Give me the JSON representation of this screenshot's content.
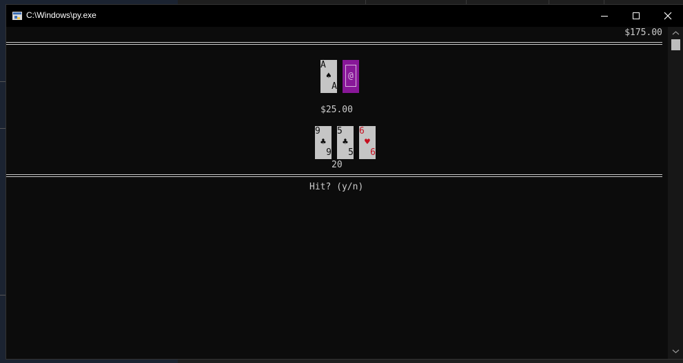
{
  "window": {
    "title": "C:\\Windows\\py.exe"
  },
  "game": {
    "bankroll": "$175.00",
    "bet": "$25.00",
    "dealer_cards": [
      {
        "rank": "A",
        "suit": "♠",
        "color": "black",
        "face_up": true
      },
      {
        "face_up": false,
        "back_symbol": "@"
      }
    ],
    "player_cards": [
      {
        "rank": "9",
        "suit": "♣",
        "color": "black"
      },
      {
        "rank": "5",
        "suit": "♣",
        "color": "black"
      },
      {
        "rank": "6",
        "suit": "♥",
        "color": "red"
      }
    ],
    "player_total": "20",
    "prompt": "Hit? (y/n)"
  },
  "colors": {
    "console_bg": "#0c0c0c",
    "console_text": "#cccccc",
    "card_face": "#c5c5c5",
    "card_back": "#881798",
    "red_suit": "#c50f1f"
  }
}
